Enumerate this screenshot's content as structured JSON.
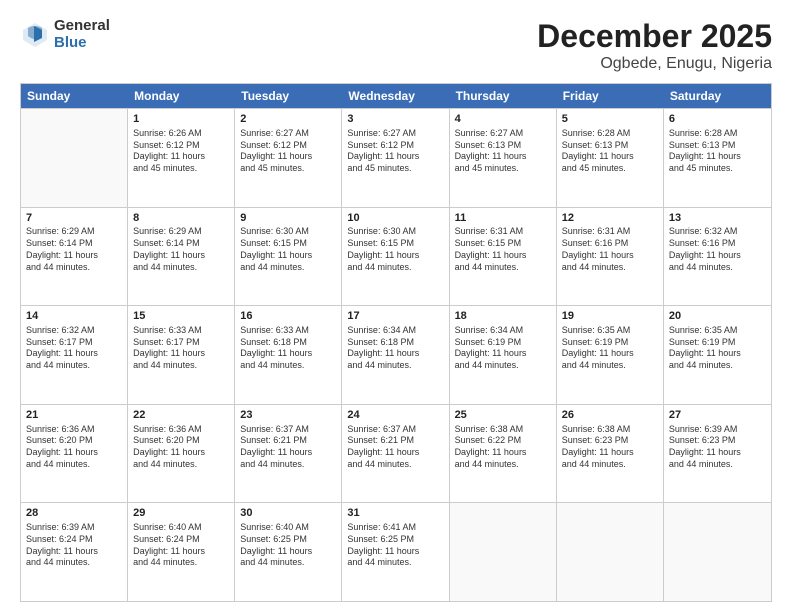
{
  "logo": {
    "general": "General",
    "blue": "Blue"
  },
  "title": "December 2025",
  "subtitle": "Ogbede, Enugu, Nigeria",
  "weekdays": [
    "Sunday",
    "Monday",
    "Tuesday",
    "Wednesday",
    "Thursday",
    "Friday",
    "Saturday"
  ],
  "weeks": [
    [
      {
        "day": "",
        "info": ""
      },
      {
        "day": "1",
        "info": "Sunrise: 6:26 AM\nSunset: 6:12 PM\nDaylight: 11 hours\nand 45 minutes."
      },
      {
        "day": "2",
        "info": "Sunrise: 6:27 AM\nSunset: 6:12 PM\nDaylight: 11 hours\nand 45 minutes."
      },
      {
        "day": "3",
        "info": "Sunrise: 6:27 AM\nSunset: 6:12 PM\nDaylight: 11 hours\nand 45 minutes."
      },
      {
        "day": "4",
        "info": "Sunrise: 6:27 AM\nSunset: 6:13 PM\nDaylight: 11 hours\nand 45 minutes."
      },
      {
        "day": "5",
        "info": "Sunrise: 6:28 AM\nSunset: 6:13 PM\nDaylight: 11 hours\nand 45 minutes."
      },
      {
        "day": "6",
        "info": "Sunrise: 6:28 AM\nSunset: 6:13 PM\nDaylight: 11 hours\nand 45 minutes."
      }
    ],
    [
      {
        "day": "7",
        "info": "Sunrise: 6:29 AM\nSunset: 6:14 PM\nDaylight: 11 hours\nand 44 minutes."
      },
      {
        "day": "8",
        "info": "Sunrise: 6:29 AM\nSunset: 6:14 PM\nDaylight: 11 hours\nand 44 minutes."
      },
      {
        "day": "9",
        "info": "Sunrise: 6:30 AM\nSunset: 6:15 PM\nDaylight: 11 hours\nand 44 minutes."
      },
      {
        "day": "10",
        "info": "Sunrise: 6:30 AM\nSunset: 6:15 PM\nDaylight: 11 hours\nand 44 minutes."
      },
      {
        "day": "11",
        "info": "Sunrise: 6:31 AM\nSunset: 6:15 PM\nDaylight: 11 hours\nand 44 minutes."
      },
      {
        "day": "12",
        "info": "Sunrise: 6:31 AM\nSunset: 6:16 PM\nDaylight: 11 hours\nand 44 minutes."
      },
      {
        "day": "13",
        "info": "Sunrise: 6:32 AM\nSunset: 6:16 PM\nDaylight: 11 hours\nand 44 minutes."
      }
    ],
    [
      {
        "day": "14",
        "info": "Sunrise: 6:32 AM\nSunset: 6:17 PM\nDaylight: 11 hours\nand 44 minutes."
      },
      {
        "day": "15",
        "info": "Sunrise: 6:33 AM\nSunset: 6:17 PM\nDaylight: 11 hours\nand 44 minutes."
      },
      {
        "day": "16",
        "info": "Sunrise: 6:33 AM\nSunset: 6:18 PM\nDaylight: 11 hours\nand 44 minutes."
      },
      {
        "day": "17",
        "info": "Sunrise: 6:34 AM\nSunset: 6:18 PM\nDaylight: 11 hours\nand 44 minutes."
      },
      {
        "day": "18",
        "info": "Sunrise: 6:34 AM\nSunset: 6:19 PM\nDaylight: 11 hours\nand 44 minutes."
      },
      {
        "day": "19",
        "info": "Sunrise: 6:35 AM\nSunset: 6:19 PM\nDaylight: 11 hours\nand 44 minutes."
      },
      {
        "day": "20",
        "info": "Sunrise: 6:35 AM\nSunset: 6:19 PM\nDaylight: 11 hours\nand 44 minutes."
      }
    ],
    [
      {
        "day": "21",
        "info": "Sunrise: 6:36 AM\nSunset: 6:20 PM\nDaylight: 11 hours\nand 44 minutes."
      },
      {
        "day": "22",
        "info": "Sunrise: 6:36 AM\nSunset: 6:20 PM\nDaylight: 11 hours\nand 44 minutes."
      },
      {
        "day": "23",
        "info": "Sunrise: 6:37 AM\nSunset: 6:21 PM\nDaylight: 11 hours\nand 44 minutes."
      },
      {
        "day": "24",
        "info": "Sunrise: 6:37 AM\nSunset: 6:21 PM\nDaylight: 11 hours\nand 44 minutes."
      },
      {
        "day": "25",
        "info": "Sunrise: 6:38 AM\nSunset: 6:22 PM\nDaylight: 11 hours\nand 44 minutes."
      },
      {
        "day": "26",
        "info": "Sunrise: 6:38 AM\nSunset: 6:23 PM\nDaylight: 11 hours\nand 44 minutes."
      },
      {
        "day": "27",
        "info": "Sunrise: 6:39 AM\nSunset: 6:23 PM\nDaylight: 11 hours\nand 44 minutes."
      }
    ],
    [
      {
        "day": "28",
        "info": "Sunrise: 6:39 AM\nSunset: 6:24 PM\nDaylight: 11 hours\nand 44 minutes."
      },
      {
        "day": "29",
        "info": "Sunrise: 6:40 AM\nSunset: 6:24 PM\nDaylight: 11 hours\nand 44 minutes."
      },
      {
        "day": "30",
        "info": "Sunrise: 6:40 AM\nSunset: 6:25 PM\nDaylight: 11 hours\nand 44 minutes."
      },
      {
        "day": "31",
        "info": "Sunrise: 6:41 AM\nSunset: 6:25 PM\nDaylight: 11 hours\nand 44 minutes."
      },
      {
        "day": "",
        "info": ""
      },
      {
        "day": "",
        "info": ""
      },
      {
        "day": "",
        "info": ""
      }
    ]
  ]
}
